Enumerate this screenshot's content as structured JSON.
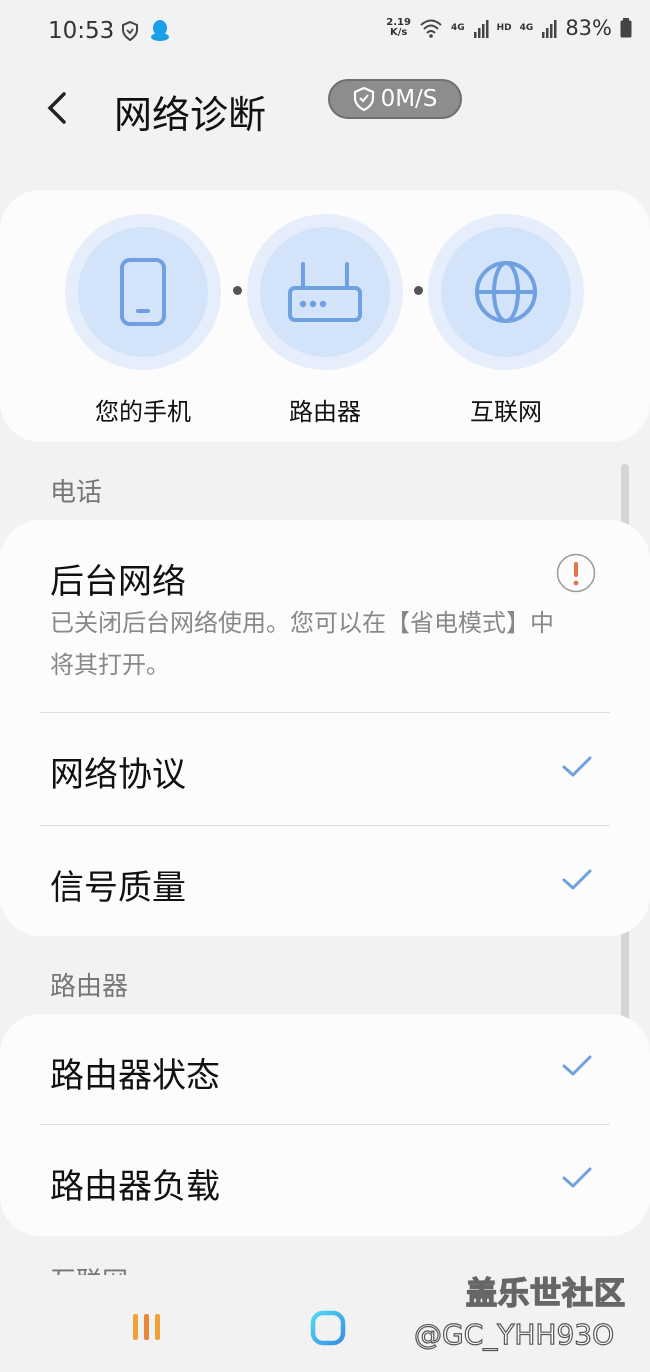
{
  "status_bar": {
    "time": "10:53",
    "speed_value": "2.19",
    "speed_unit": "K/s",
    "net_label_1": "4G",
    "hd_label": "HD",
    "net_label_2": "4G",
    "battery": "83%"
  },
  "app_bar": {
    "title": "网络诊断",
    "speed_badge": "0M/S"
  },
  "topology": {
    "nodes": [
      {
        "label": "您的手机",
        "icon": "phone-icon"
      },
      {
        "label": "路由器",
        "icon": "router-icon"
      },
      {
        "label": "互联网",
        "icon": "globe-icon"
      }
    ]
  },
  "sections": {
    "phone": {
      "header": "电话",
      "items": [
        {
          "title": "后台网络",
          "description": "已关闭后台网络使用。您可以在【省电模式】中将其打开。",
          "status": "warning"
        },
        {
          "title": "网络协议",
          "status": "ok"
        },
        {
          "title": "信号质量",
          "status": "ok"
        }
      ]
    },
    "router": {
      "header": "路由器",
      "items": [
        {
          "title": "路由器状态",
          "status": "ok"
        },
        {
          "title": "路由器负载",
          "status": "ok"
        }
      ]
    },
    "internet": {
      "header": "互联网"
    }
  },
  "watermark": {
    "line1": "盖乐世社区",
    "line2": "@GC_YHH93O"
  },
  "colors": {
    "accent_blue": "#6fa0e0",
    "warning_orange": "#e8734a"
  }
}
